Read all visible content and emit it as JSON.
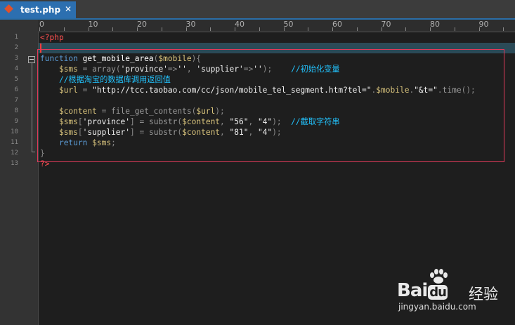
{
  "tab": {
    "filename": "test.php",
    "close": "✕",
    "icon": "php-file-icon"
  },
  "ruler": {
    "labels": [
      "0",
      "10",
      "20",
      "30",
      "40",
      "50",
      "60",
      "70",
      "80",
      "90"
    ]
  },
  "line_numbers": [
    "1",
    "2",
    "3",
    "4",
    "5",
    "6",
    "7",
    "8",
    "9",
    "10",
    "11",
    "12",
    "13"
  ],
  "code": {
    "l1_open": "<?php",
    "l3_kw": "function",
    "l3_name": " get_mobile_area",
    "l3_p1": "(",
    "l3_var": "$mobile",
    "l3_p2": "){",
    "l4_indent": "    ",
    "l4_var": "$sms",
    "l4_eq": " = ",
    "l4_fn": "array",
    "l4_p1": "(",
    "l4_s1": "'province'",
    "l4_arrow1": "=>",
    "l4_s2": "''",
    "l4_comma": ", ",
    "l4_s3": "'supplier'",
    "l4_arrow2": "=>",
    "l4_s4": "''",
    "l4_p2": ");",
    "l4_gap": "    ",
    "l4_comment": "//初始化变量",
    "l5_indent": "    ",
    "l5_comment": "//根据淘宝的数据库调用返回值",
    "l6_indent": "    ",
    "l6_var": "$url",
    "l6_eq": " = ",
    "l6_str": "\"http://tcc.taobao.com/cc/json/mobile_tel_segment.htm?tel=\"",
    "l6_dot1": ".",
    "l6_var2": "$mobile",
    "l6_dot2": ".",
    "l6_str2": "\"&t=\"",
    "l6_dot3": ".",
    "l6_fn": "time",
    "l6_end": "();",
    "l8_indent": "    ",
    "l8_var": "$content",
    "l8_eq": " = ",
    "l8_fn": "file_get_contents",
    "l8_p1": "(",
    "l8_var2": "$url",
    "l8_p2": ");",
    "l9_indent": "    ",
    "l9_var": "$sms",
    "l9_b1": "[",
    "l9_key": "'province'",
    "l9_b2": "]",
    "l9_eq": " = ",
    "l9_fn": "substr",
    "l9_p1": "(",
    "l9_var2": "$content",
    "l9_c1": ", ",
    "l9_n1": "\"56\"",
    "l9_c2": ", ",
    "l9_n2": "\"4\"",
    "l9_p2": ");",
    "l9_gap": "  ",
    "l9_comment": "//截取字符串",
    "l10_indent": "    ",
    "l10_var": "$sms",
    "l10_b1": "[",
    "l10_key": "'supplier'",
    "l10_b2": "]",
    "l10_eq": " = ",
    "l10_fn": "substr",
    "l10_p1": "(",
    "l10_var2": "$content",
    "l10_c1": ", ",
    "l10_n1": "\"81\"",
    "l10_c2": ", ",
    "l10_n2": "\"4\"",
    "l10_p2": ");",
    "l11_indent": "    ",
    "l11_kw": "return",
    "l11_sp": " ",
    "l11_var": "$sms",
    "l11_end": ";",
    "l12_brace": "}",
    "l13_close": "?>"
  },
  "watermark": {
    "brand": "Bai",
    "brand_du": "du",
    "brand2": "经验",
    "url": "jingyan.baidu.com"
  },
  "colors": {
    "tab_active": "#2c6fb0",
    "highlight_box": "#e03a5a",
    "current_line": "#2b4a57",
    "comment": "#22c4ff"
  }
}
